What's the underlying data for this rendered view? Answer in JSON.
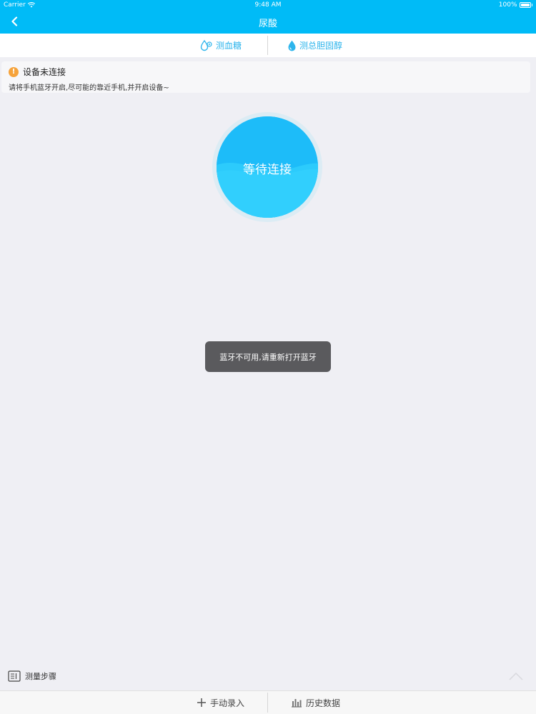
{
  "status_bar": {
    "carrier": "Carrier",
    "time": "9:48 AM",
    "battery": "100%"
  },
  "nav": {
    "title": "尿酸",
    "back_icon": "chevron-left-icon"
  },
  "tabs": [
    {
      "label": "测血糖",
      "icon": "blood-drop-icon"
    },
    {
      "label": "测总胆固醇",
      "icon": "water-drop-icon"
    }
  ],
  "warning": {
    "title": "设备未连接",
    "description": "请将手机蓝牙开启,尽可能的靠近手机,并开启设备~",
    "icon_glyph": "!"
  },
  "connect": {
    "label": "等待连接"
  },
  "toast": {
    "message": "蓝牙不可用,请重新打开蓝牙"
  },
  "steps": {
    "label": "测量步骤"
  },
  "bottom_bar": {
    "manual_entry": "手动录入",
    "history": "历史数据"
  },
  "colors": {
    "primary": "#00bbf7",
    "tab_text": "#2eb5ec",
    "warning": "#f6a33b",
    "background": "#efeff4"
  }
}
